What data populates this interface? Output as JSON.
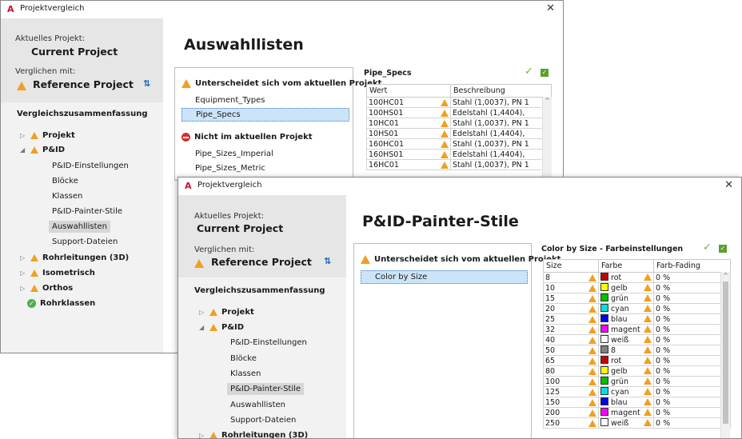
{
  "w1": {
    "title": "Projektvergleich",
    "current_label": "Aktuelles Projekt:",
    "current_name": "Current Project",
    "compared_label": "Verglichen mit:",
    "compared_name": "Reference Project",
    "summary_title": "Vergleichszusammenfassung",
    "tree": [
      "Projekt",
      "P&ID",
      "P&ID-Einstellungen",
      "Blöcke",
      "Klassen",
      "P&ID-Painter-Stile",
      "Auswahllisten",
      "Support-Dateien",
      "Rohrleitungen (3D)",
      "Isometrisch",
      "Orthos",
      "Rohrklassen"
    ],
    "heading": "Auswahllisten",
    "list": {
      "group1": "Unterscheidet sich vom aktuellen Projekt",
      "group1_items": [
        "Equipment_Types",
        "Pipe_Specs"
      ],
      "group2": "Nicht im aktuellen Projekt",
      "group2_items": [
        "Pipe_Sizes_Imperial",
        "Pipe_Sizes_Metric"
      ]
    },
    "grid": {
      "title": "Pipe_Specs",
      "columns": [
        "Wert",
        "Beschreibung"
      ],
      "rows": [
        [
          "100HC01",
          "Stahl (1,0037), PN 1"
        ],
        [
          "100HS01",
          "Edelstahl (1,4404),"
        ],
        [
          "10HC01",
          "Stahl (1,0037), PN 1"
        ],
        [
          "10HS01",
          "Edelstahl (1,4404),"
        ],
        [
          "160HC01",
          "Stahl (1,0037), PN 1"
        ],
        [
          "160HS01",
          "Edelstahl (1,4404),"
        ],
        [
          "16HC01",
          "Stahl (1,0037), PN 1"
        ]
      ]
    }
  },
  "w2": {
    "title": "Projektvergleich",
    "current_label": "Aktuelles Projekt:",
    "current_name": "Current Project",
    "compared_label": "Verglichen mit:",
    "compared_name": "Reference Project",
    "summary_title": "Vergleichszusammenfassung",
    "tree": [
      "Projekt",
      "P&ID",
      "P&ID-Einstellungen",
      "Blöcke",
      "Klassen",
      "P&ID-Painter-Stile",
      "Auswahllisten",
      "Support-Dateien",
      "Rohrleitungen (3D)"
    ],
    "heading": "P&ID-Painter-Stile",
    "list": {
      "group1": "Unterscheidet sich vom aktuellen Projekt",
      "group1_items": [
        "Color by Size"
      ]
    },
    "grid": {
      "title": "Color by Size  - Farbeinstellungen",
      "columns": [
        "Size",
        "Farbe",
        "Farb-Fading"
      ],
      "rows": [
        [
          "8",
          "rot",
          "0 %"
        ],
        [
          "10",
          "gelb",
          "0 %"
        ],
        [
          "15",
          "grün",
          "0 %"
        ],
        [
          "20",
          "cyan",
          "0 %"
        ],
        [
          "25",
          "blau",
          "0 %"
        ],
        [
          "32",
          "magent",
          "0 %"
        ],
        [
          "40",
          "weiß",
          "0 %"
        ],
        [
          "50",
          "8",
          "0 %"
        ],
        [
          "65",
          "rot",
          "0 %"
        ],
        [
          "80",
          "gelb",
          "0 %"
        ],
        [
          "100",
          "grün",
          "0 %"
        ],
        [
          "125",
          "cyan",
          "0 %"
        ],
        [
          "150",
          "blau",
          "0 %"
        ],
        [
          "200",
          "magent",
          "0 %"
        ],
        [
          "250",
          "weiß",
          "0 %"
        ]
      ],
      "swatch_colors": [
        "#cc0000",
        "#ffff00",
        "#00c000",
        "#00e0e0",
        "#0000ee",
        "#ff00ff",
        "#ffffff",
        "#808080",
        "#cc0000",
        "#ffff00",
        "#00c000",
        "#00e0e0",
        "#0000ee",
        "#ff00ff",
        "#ffffff"
      ]
    }
  },
  "colors": {
    "accent_warn": "#f0a020",
    "selection": "#cce4f7",
    "sidebar": "#f2f2f2",
    "brand": "#c8102e"
  }
}
